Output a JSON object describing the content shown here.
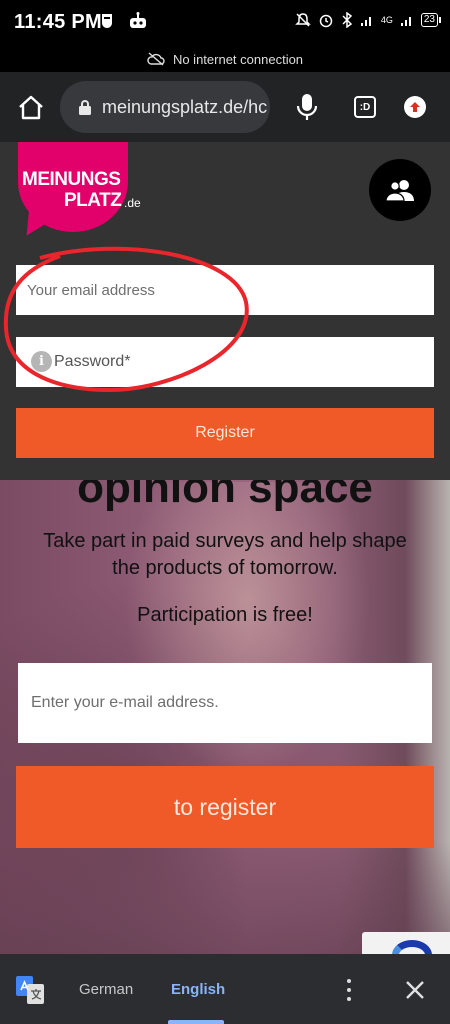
{
  "status_bar": {
    "time": "11:45 PM",
    "network": "4G",
    "battery": "23",
    "icons": [
      "message-icon",
      "robot-icon",
      "mute-icon",
      "alarm-icon",
      "bluetooth-icon",
      "signal-icon",
      "signal-icon",
      "battery-icon"
    ]
  },
  "offline_banner": {
    "text": "No internet connection",
    "icon": "cloud-off-icon"
  },
  "browser": {
    "url": "meinungsplatz.de/hc",
    "tab_count_label": ":D",
    "icons": [
      "home-icon",
      "lock-icon",
      "mic-icon",
      "tabs-icon",
      "update-icon"
    ]
  },
  "header": {
    "logo_line1": "MEINUNGS",
    "logo_line2": "PLATZ",
    "logo_suffix": ".de",
    "email_placeholder": "Your email address",
    "password_placeholder": "Password*",
    "register_label": "Register",
    "brand_color": "#e2006a",
    "accent_color": "#f05a28"
  },
  "hero": {
    "headline": "opinion space",
    "subline": "Take part in paid surveys and help shape the products of tomorrow.",
    "free_line": "Participation is free!",
    "email_placeholder": "Enter your e-mail address.",
    "cta_label": "to register"
  },
  "translate_bar": {
    "source_language": "German",
    "target_language": "English",
    "selected": "English",
    "icons": [
      "google-translate-icon",
      "more-vert-icon",
      "close-icon"
    ]
  }
}
